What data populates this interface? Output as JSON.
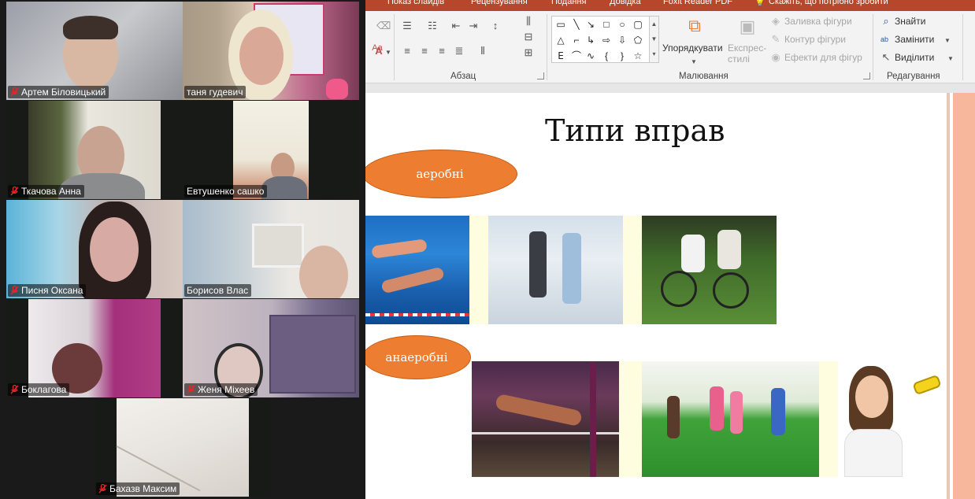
{
  "conference": {
    "participants": [
      {
        "name": "Артем Біловицький",
        "muted": true
      },
      {
        "name": "таня гудевич",
        "muted": false
      },
      {
        "name": "Ткачова Анна",
        "muted": true
      },
      {
        "name": "Евтушенко сашко",
        "muted": false
      },
      {
        "name": "Писня Оксана",
        "muted": true
      },
      {
        "name": "Борисов Влас",
        "muted": false,
        "active": true
      },
      {
        "name": "Боклагова",
        "muted": true
      },
      {
        "name": "Женя Міхеев",
        "muted": true
      },
      {
        "name": "Бахазв Максим",
        "muted": true
      }
    ]
  },
  "ppt": {
    "tabs": [
      "Показ слайдів",
      "Рецензування",
      "Подання",
      "Довідка",
      "Foxit Reader PDF",
      "Скажіть, що потрібно зробити"
    ],
    "ribbon": {
      "paragraph_label": "Абзац",
      "drawing_label": "Малювання",
      "editing_label": "Редагування",
      "arrange_label": "Упорядкувати",
      "quick_styles_label": "Експрес-стилі",
      "shape_fill": "Заливка фігури",
      "shape_outline": "Контур фігури",
      "shape_effects": "Ефекти для фігур",
      "find": "Знайти",
      "replace": "Замінити",
      "select": "Виділити"
    },
    "slide": {
      "title": "Типи вправ",
      "aerobic_label": "аеробні",
      "anaerobic_label": "анаеробні"
    }
  },
  "colors": {
    "accent_orange": "#ed7d31",
    "ppt_red": "#b7472a",
    "active_speaker": "#23d160"
  }
}
